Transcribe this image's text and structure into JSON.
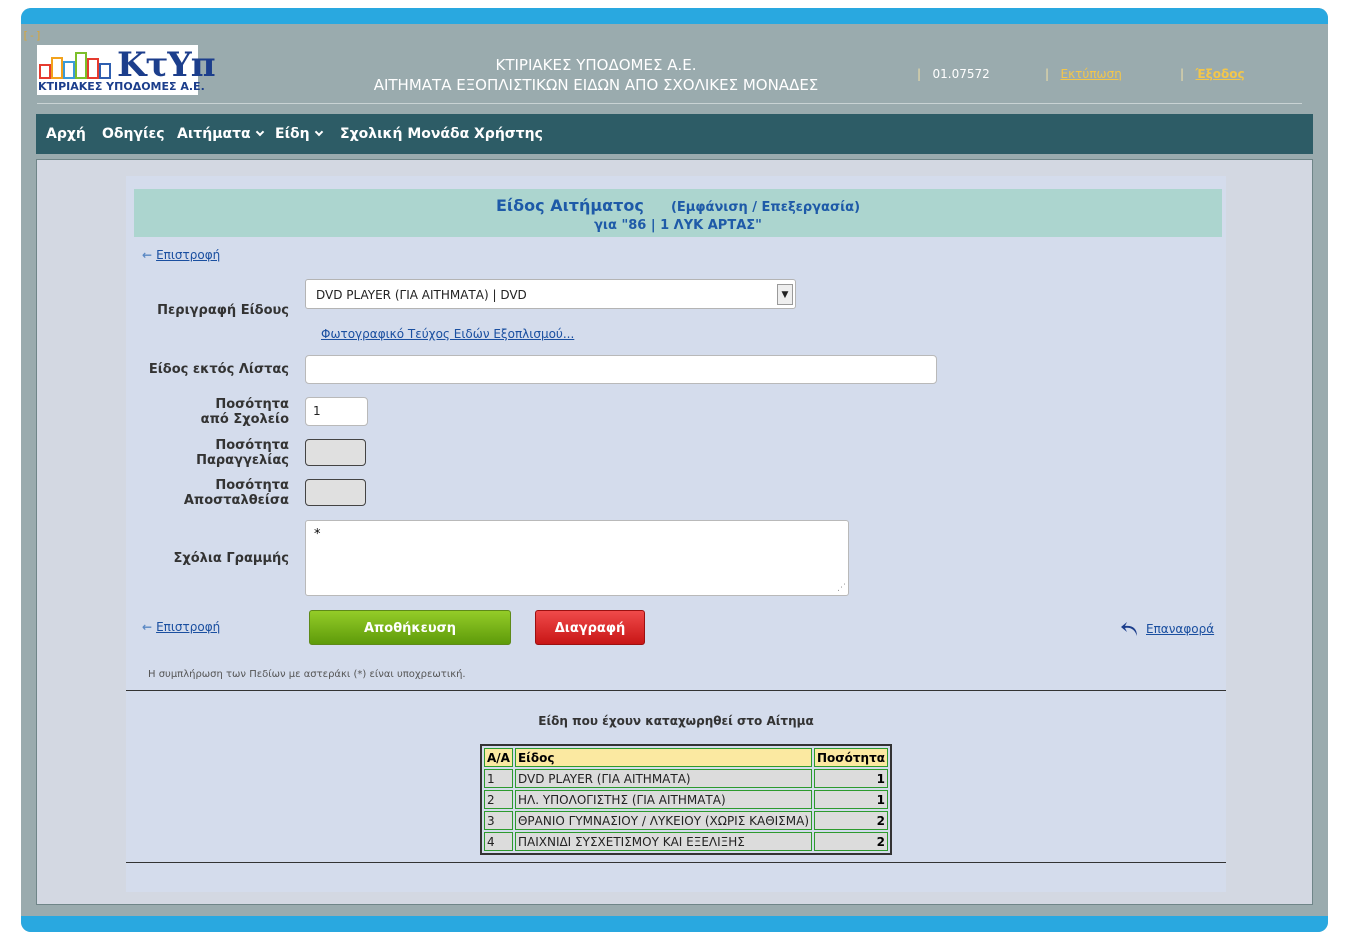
{
  "header": {
    "collapse_label": "[-]",
    "logo_brand": "ΚτΥπ",
    "logo_sub": "ΚΤΙΡΙΑΚΕΣ ΥΠΟΔΟΜΕΣ Α.Ε.",
    "title_line1": "ΚΤΙΡΙΑΚΕΣ ΥΠΟΔΟΜΕΣ Α.Ε.",
    "title_line2": "ΑΙΤΗΜΑΤΑ ΕΞΟΠΛΙΣΤΙΚΩΝ ΕΙΔΩΝ ΑΠΟ ΣΧΟΛΙΚΕΣ ΜΟΝΑΔΕΣ",
    "version": "01.07572",
    "print_label": "Εκτύπωση",
    "logout_label": "Έξοδος",
    "separator": "|"
  },
  "nav": {
    "items": [
      {
        "label": "Αρχή"
      },
      {
        "label": "Οδηγίες"
      },
      {
        "label": "Αιτήματα"
      },
      {
        "label": "Είδη"
      },
      {
        "label": "Σχολική Μονάδα"
      },
      {
        "label": "Χρήστης"
      }
    ]
  },
  "form": {
    "title": "Είδος Αιτήματος",
    "subtitle": "(Εμφάνιση / Επεξεργασία)",
    "for_line": "για \"86 | 1 ΛΥΚ ΑΡΤΑΣ\"",
    "back_label": "Επιστροφή",
    "description_label": "Περιγραφή Είδους",
    "description_value": "DVD PLAYER (ΓΙΑ ΑΙΤΗΜΑΤΑ) | DVD",
    "photo_link": "Φωτογραφικό Τεύχος Ειδών Εξοπλισμού...",
    "off_list_label": "Είδος εκτός Λίστας",
    "off_list_value": "",
    "qty_school_label_1": "Ποσότητα",
    "qty_school_label_2": "από Σχολείο",
    "qty_school_value": "1",
    "qty_order_label_1": "Ποσότητα",
    "qty_order_label_2": "Παραγγελίας",
    "qty_sent_label_1": "Ποσότητα",
    "qty_sent_label_2": "Αποσταλθείσα",
    "comments_label": "Σχόλια Γραμμής",
    "comments_value": "*",
    "save_label": "Αποθήκευση",
    "delete_label": "Διαγραφή",
    "reset_label": "Επαναφορά",
    "note": "Η συμπλήρωση των Πεδίων με αστεράκι (*) είναι υποχρεωτική."
  },
  "items": {
    "title": "Είδη που έχουν καταχωρηθεί στο Αίτημα",
    "headers": [
      "Α/Α",
      "Είδος",
      "Ποσότητα"
    ],
    "rows": [
      {
        "aa": "1",
        "item": "DVD PLAYER (ΓΙΑ ΑΙΤΗΜΑΤΑ)",
        "qty": "1"
      },
      {
        "aa": "2",
        "item": "ΗΛ. ΥΠΟΛΟΓΙΣΤΗΣ (ΓΙΑ ΑΙΤΗΜΑΤΑ)",
        "qty": "1"
      },
      {
        "aa": "3",
        "item": "ΘΡΑΝΙΟ ΓΥΜΝΑΣΙΟΥ / ΛΥΚΕΙΟΥ (ΧΩΡΙΣ ΚΑΘΙΣΜΑ)",
        "qty": "2"
      },
      {
        "aa": "4",
        "item": "ΠΑΙΧΝΙΔΙ ΣΥΣΧΕΤΙΣΜΟΥ ΚΑΙ ΕΞΕΛΙΞΗΣ",
        "qty": "2"
      }
    ]
  },
  "colors": {
    "accent_blue": "#29a8e0",
    "nav_bg": "#2d5c66",
    "save_green": "#7ab51a",
    "delete_red": "#dd2c2c",
    "link_yellow": "#f3c64a"
  }
}
